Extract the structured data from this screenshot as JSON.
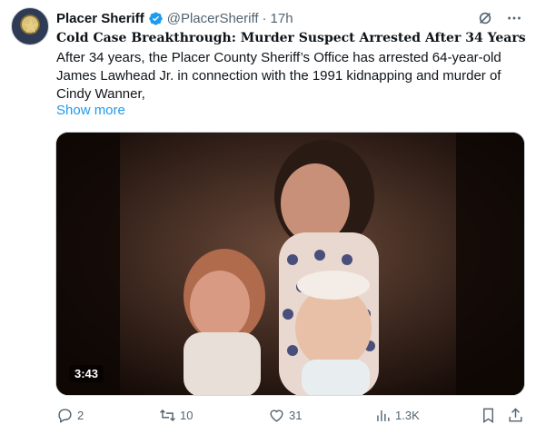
{
  "author": {
    "name": "Placer Sheriff",
    "handle": "@PlacerSheriff",
    "separator": "·",
    "time": "17h",
    "avatar_icon": "sheriff-badge-icon",
    "verified_color": "#1d9bf0"
  },
  "tweet": {
    "title": "Cold Case Breakthrough: Murder Suspect Arrested After 34 Years",
    "lines": [
      "After 34 years, the Placer County Sheriff’s Office has arrested 64-year-old",
      "James Lawhead Jr. in connection with the 1991 kidnapping and murder of",
      "Cindy Wanner,"
    ],
    "show_more": "Show more"
  },
  "media": {
    "type": "video",
    "duration": "3:43"
  },
  "actions": {
    "replies": "2",
    "reposts": "10",
    "likes": "31",
    "views": "1.3K"
  },
  "colors": {
    "accent": "#1d9bf0",
    "muted": "#536471",
    "text": "#0f1419"
  }
}
